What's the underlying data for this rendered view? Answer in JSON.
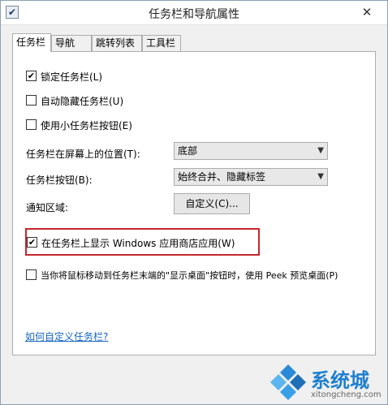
{
  "window": {
    "title": "任务栏和导航属性",
    "close_glyph": "✕"
  },
  "tabs": [
    {
      "label": "任务栏",
      "active": true
    },
    {
      "label": "导航",
      "active": false
    },
    {
      "label": "跳转列表",
      "active": false
    },
    {
      "label": "工具栏",
      "active": false
    }
  ],
  "options": {
    "lock_taskbar": {
      "label": "锁定任务栏(L)",
      "checked": true
    },
    "auto_hide": {
      "label": "自动隐藏任务栏(U)",
      "checked": false
    },
    "small_buttons": {
      "label": "使用小任务栏按钮(E)",
      "checked": false
    },
    "show_store_apps": {
      "label": "在任务栏上显示 Windows 应用商店应用(W)",
      "checked": true
    },
    "peek": {
      "label": "当你将鼠标移动到任务栏末端的\"显示桌面\"按钮时，使用 Peek 预览桌面(P)",
      "checked": false
    }
  },
  "position": {
    "label": "任务栏在屏幕上的位置(T):",
    "value": "底部"
  },
  "buttons_mode": {
    "label": "任务栏按钮(B):",
    "value": "始终合并、隐藏标签"
  },
  "notification": {
    "label": "通知区域:",
    "button": "自定义(C)..."
  },
  "help_link": "如何自定义任务栏?",
  "watermark": {
    "brand": "系统城",
    "url": "xitongcheng.com"
  },
  "colors": {
    "highlight": "#c8252b",
    "link": "#1565c0",
    "brand": "#1e7fcf"
  }
}
